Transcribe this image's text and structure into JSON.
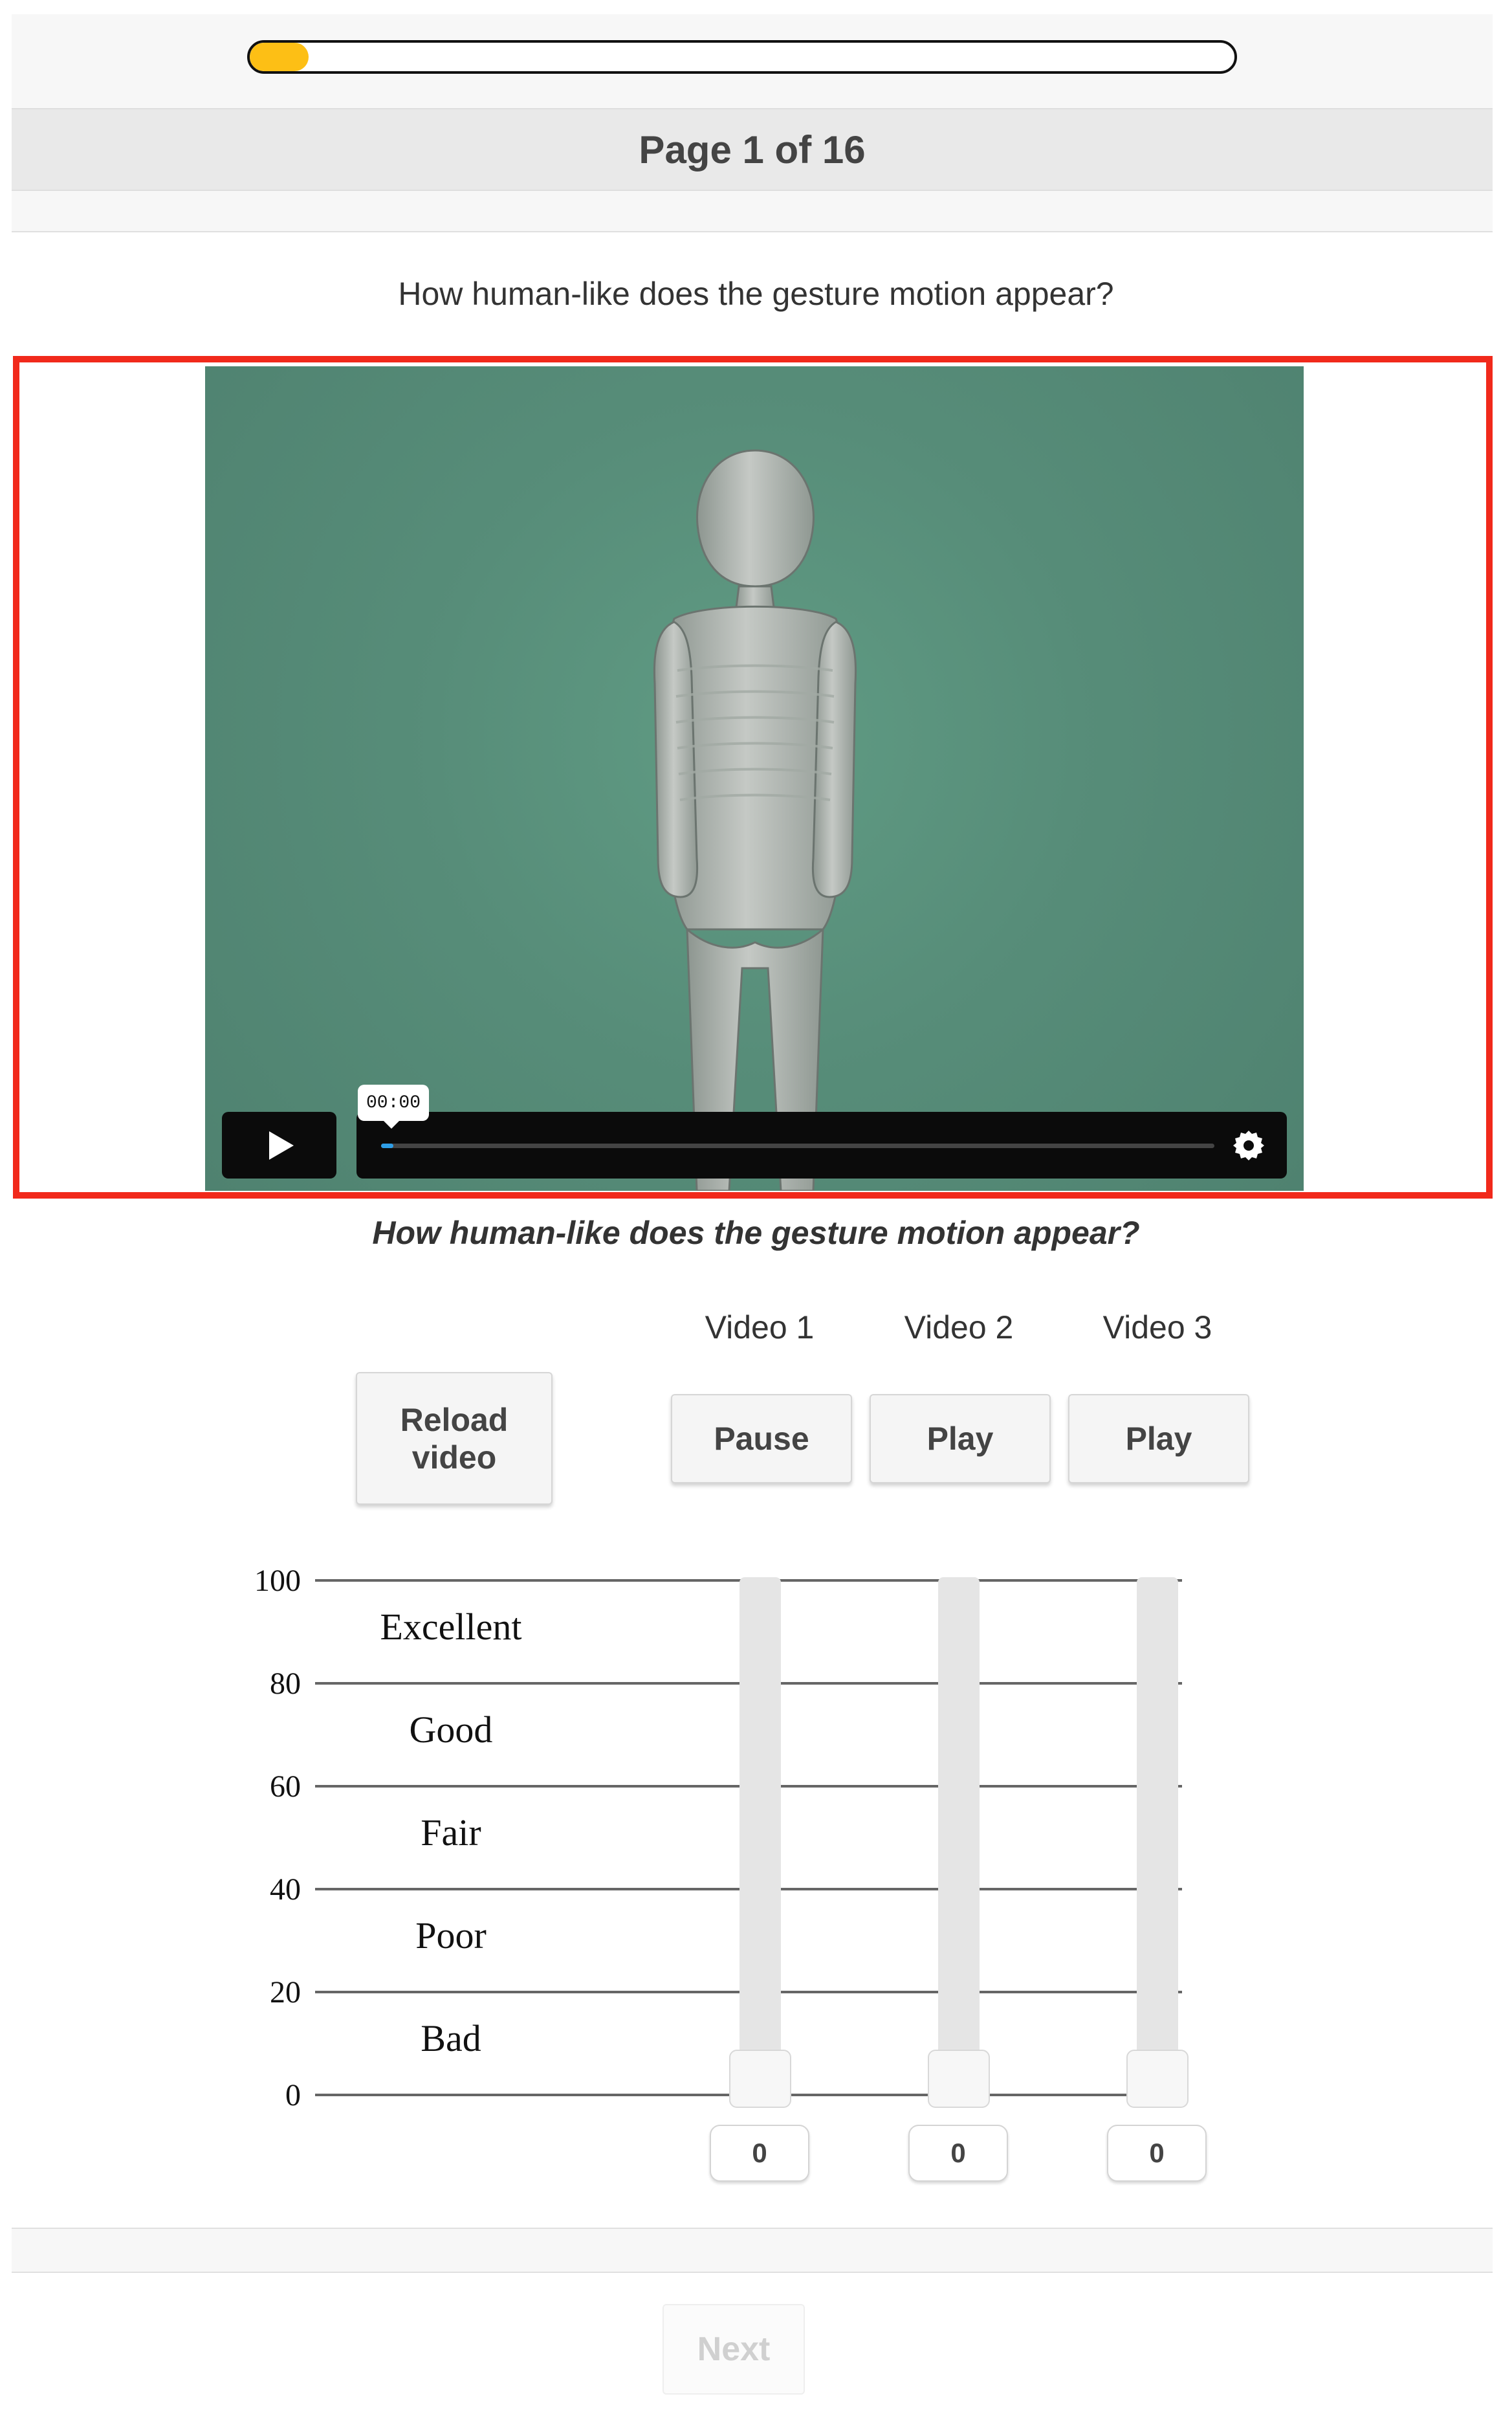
{
  "progress": {
    "fraction": 0.06,
    "fill_color": "#fdbf15"
  },
  "header": {
    "page_label": "Page 1 of 16"
  },
  "question": {
    "top_text": "How human-like does the gesture motion appear?",
    "italic_text": "How human-like does the gesture motion appear?"
  },
  "video": {
    "time_display": "00:00",
    "play_icon": "play-icon",
    "settings_icon": "gear-icon",
    "progress_fraction": 0.015,
    "highlight_color": "#f1291b"
  },
  "controls": {
    "reload_label": "Reload\nvideo",
    "video_labels": [
      "Video 1",
      "Video 2",
      "Video 3"
    ],
    "video_buttons": [
      "Pause",
      "Play",
      "Play"
    ]
  },
  "scale": {
    "ticks": [
      "100",
      "80",
      "60",
      "40",
      "20",
      "0"
    ],
    "categories": [
      "Excellent",
      "Good",
      "Fair",
      "Poor",
      "Bad"
    ]
  },
  "sliders": {
    "values": [
      "0",
      "0",
      "0"
    ],
    "levels": [
      0,
      0,
      0
    ]
  },
  "footer": {
    "next_label": "Next"
  }
}
